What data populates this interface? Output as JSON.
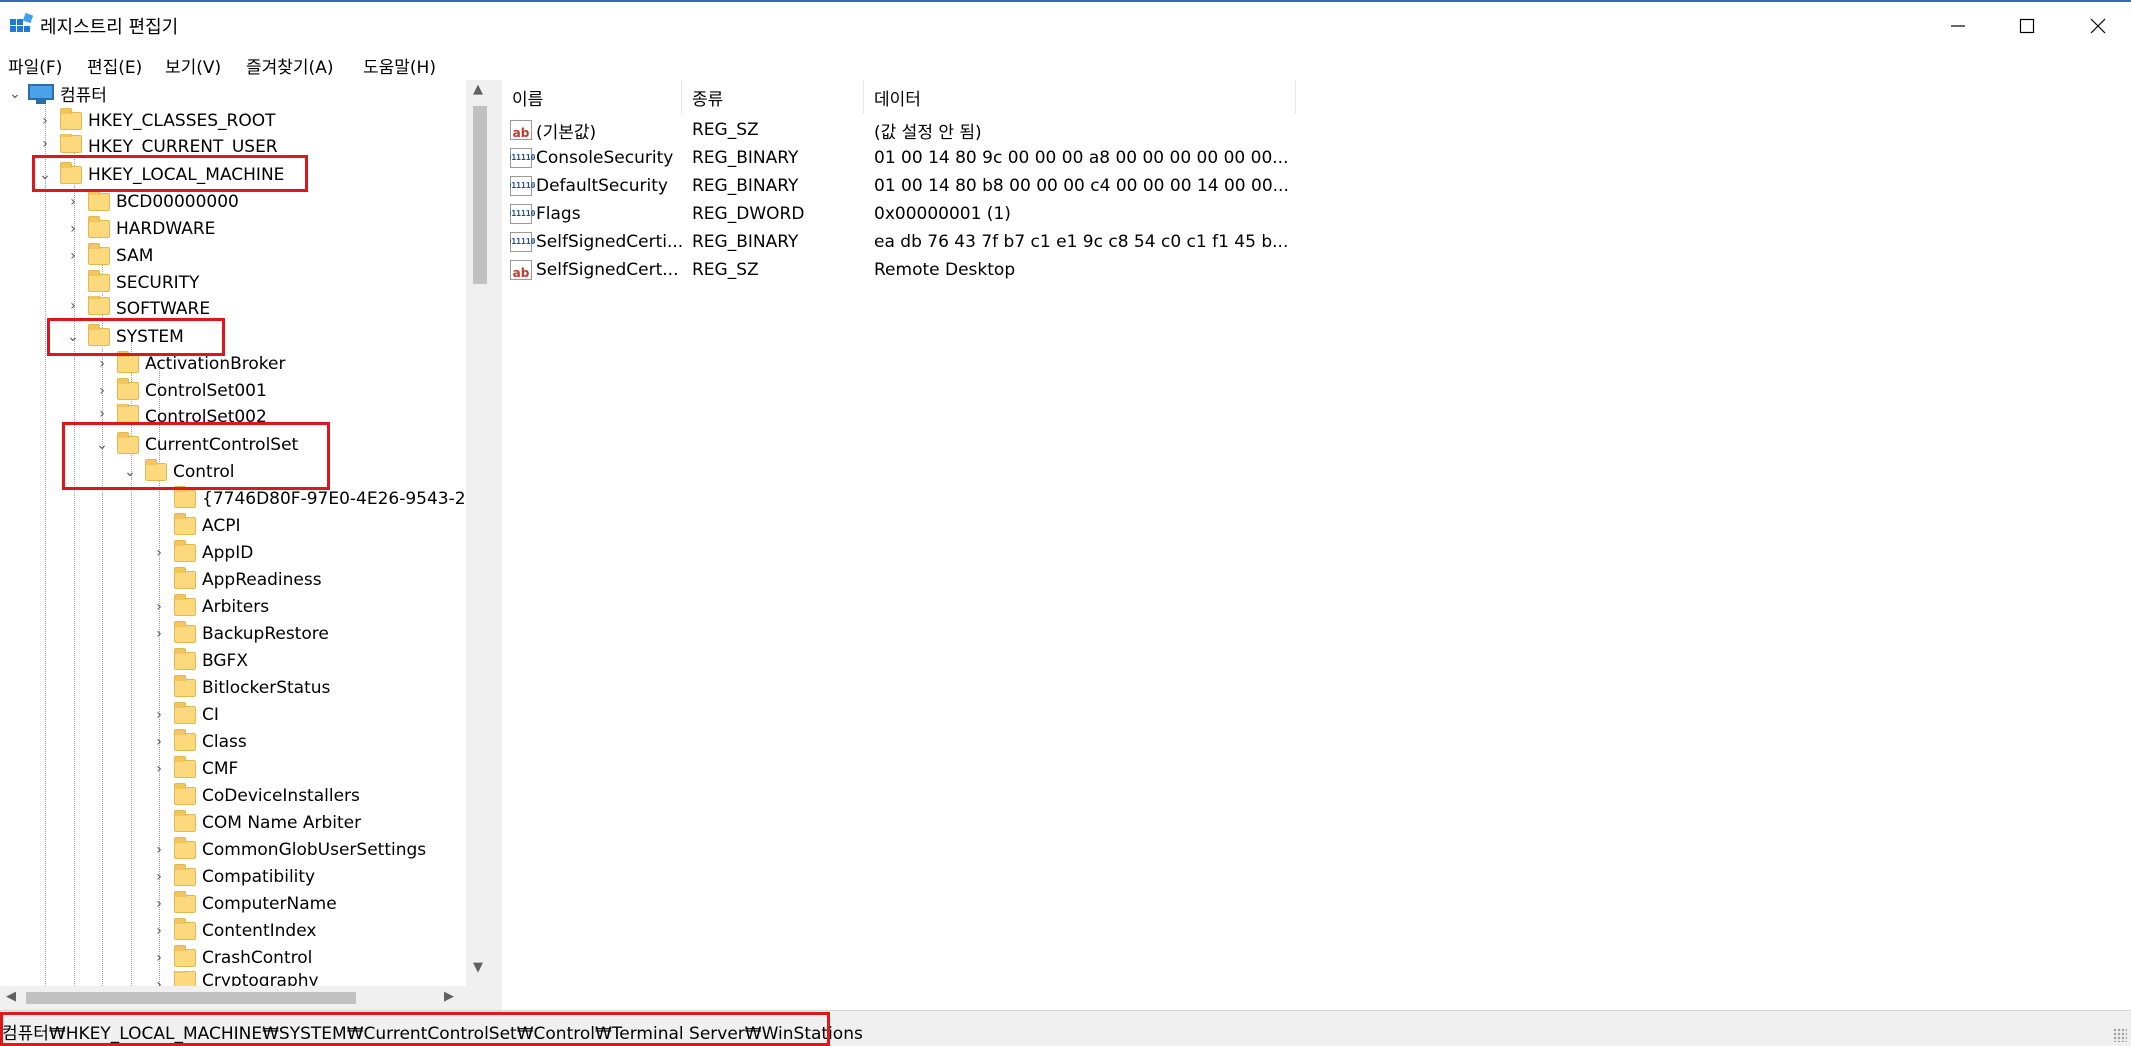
{
  "window": {
    "title": "레지스트리 편집기",
    "accent_color": "#2b6fb5"
  },
  "menu": [
    "파일(F)",
    "편집(E)",
    "보기(V)",
    "즐겨찾기(A)",
    "도움말(H)"
  ],
  "tree": {
    "root": "컴퓨터",
    "hives": [
      "HKEY_CLASSES_ROOT",
      "HKEY_CURRENT_USER",
      "HKEY_LOCAL_MACHINE"
    ],
    "hklm_children": [
      "BCD00000000",
      "HARDWARE",
      "SAM",
      "SECURITY",
      "SOFTWARE",
      "SYSTEM"
    ],
    "system_children": [
      "ActivationBroker",
      "ControlSet001",
      "ControlSet002",
      "CurrentControlSet"
    ],
    "ccs_children": [
      "Control"
    ],
    "control_children": [
      "{7746D80F-97E0-4E26-9543-2(",
      "ACPI",
      "AppID",
      "AppReadiness",
      "Arbiters",
      "BackupRestore",
      "BGFX",
      "BitlockerStatus",
      "CI",
      "Class",
      "CMF",
      "CoDeviceInstallers",
      "COM Name Arbiter",
      "CommonGlobUserSettings",
      "Compatibility",
      "ComputerName",
      "ContentIndex",
      "CrashControl",
      "Cryptography"
    ]
  },
  "columns": {
    "name": "이름",
    "type": "종류",
    "data": "데이터"
  },
  "values": [
    {
      "icon": "string",
      "name": "(기본값)",
      "type": "REG_SZ",
      "data": "(값 설정 안 됨)"
    },
    {
      "icon": "binary",
      "name": "ConsoleSecurity",
      "type": "REG_BINARY",
      "data": "01 00 14 80 9c 00 00 00 a8 00 00 00 00 00 00..."
    },
    {
      "icon": "binary",
      "name": "DefaultSecurity",
      "type": "REG_BINARY",
      "data": "01 00 14 80 b8 00 00 00 c4 00 00 00 14 00 00..."
    },
    {
      "icon": "binary",
      "name": "Flags",
      "type": "REG_DWORD",
      "data": "0x00000001 (1)"
    },
    {
      "icon": "binary",
      "name": "SelfSignedCerti...",
      "type": "REG_BINARY",
      "data": "ea db 76 43 7f b7 c1 e1 9c c8 54 c0 c1 f1 45 b..."
    },
    {
      "icon": "string",
      "name": "SelfSignedCert...",
      "type": "REG_SZ",
      "data": "Remote Desktop"
    }
  ],
  "icons": {
    "string": "ab",
    "binary_top": "011",
    "binary_bottom": "110"
  },
  "status": {
    "path": "컴퓨터₩HKEY_LOCAL_MACHINE₩SYSTEM₩CurrentControlSet₩Control₩Terminal Server₩WinStations"
  },
  "highlight_color": "#e0161c"
}
